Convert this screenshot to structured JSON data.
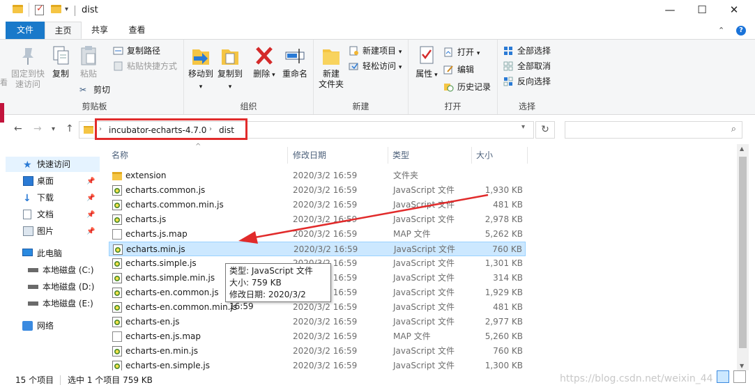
{
  "window": {
    "title": "dist",
    "minimize": "—",
    "maximize": "☐",
    "close": "✕"
  },
  "tabs": [
    "文件",
    "主页",
    "共享",
    "查看"
  ],
  "ribbon": {
    "clipboard": {
      "label": "剪贴板",
      "pin_line1": "固定到快",
      "pin_line2": "速访问",
      "copy": "复制",
      "paste": "粘贴",
      "copy_path": "复制路径",
      "paste_shortcut": "粘贴快捷方式",
      "cut": "剪切"
    },
    "organize": {
      "label": "组织",
      "move_to": "移动到",
      "copy_to": "复制到",
      "delete": "删除",
      "rename": "重命名"
    },
    "new": {
      "label": "新建",
      "new_folder_line1": "新建",
      "new_folder_line2": "文件夹",
      "new_item": "新建项目",
      "easy_access": "轻松访问"
    },
    "open": {
      "label": "打开",
      "properties": "属性",
      "open": "打开",
      "edit": "编辑",
      "history": "历史记录"
    },
    "select": {
      "label": "选择",
      "select_all": "全部选择",
      "select_none": "全部取消",
      "invert": "反向选择"
    }
  },
  "address": {
    "crumbs": [
      "incubator-echarts-4.7.0",
      "dist"
    ]
  },
  "navpane": {
    "quick_access": "快速访问",
    "desktop": "桌面",
    "downloads": "下载",
    "documents": "文档",
    "pictures": "图片",
    "this_pc": "此电脑",
    "drive_c": "本地磁盘 (C:)",
    "drive_d": "本地磁盘 (D:)",
    "drive_e": "本地磁盘 (E:)",
    "network": "网络"
  },
  "columns": {
    "name": "名称",
    "date": "修改日期",
    "type": "类型",
    "size": "大小"
  },
  "files": [
    {
      "name": "extension",
      "date": "2020/3/2 16:59",
      "type": "文件夹",
      "size": "",
      "icon": "folder-icon"
    },
    {
      "name": "echarts.common.js",
      "date": "2020/3/2 16:59",
      "type": "JavaScript 文件",
      "size": "1,930 KB",
      "icon": "js-file-icon"
    },
    {
      "name": "echarts.common.min.js",
      "date": "2020/3/2 16:59",
      "type": "JavaScript 文件",
      "size": "481 KB",
      "icon": "js-file-icon"
    },
    {
      "name": "echarts.js",
      "date": "2020/3/2 16:59",
      "type": "JavaScript 文件",
      "size": "2,978 KB",
      "icon": "js-file-icon"
    },
    {
      "name": "echarts.js.map",
      "date": "2020/3/2 16:59",
      "type": "MAP 文件",
      "size": "5,262 KB",
      "icon": "map-file-icon"
    },
    {
      "name": "echarts.min.js",
      "date": "2020/3/2 16:59",
      "type": "JavaScript 文件",
      "size": "760 KB",
      "icon": "js-file-icon"
    },
    {
      "name": "echarts.simple.js",
      "date": "2020/3/2 16:59",
      "type": "JavaScript 文件",
      "size": "1,301 KB",
      "icon": "js-file-icon"
    },
    {
      "name": "echarts.simple.min.js",
      "date": "2020/3/2 16:59",
      "type": "JavaScript 文件",
      "size": "314 KB",
      "icon": "js-file-icon"
    },
    {
      "name": "echarts-en.common.js",
      "date": "2020/3/2 16:59",
      "type": "JavaScript 文件",
      "size": "1,929 KB",
      "icon": "js-file-icon"
    },
    {
      "name": "echarts-en.common.min.js",
      "date": "2020/3/2 16:59",
      "type": "JavaScript 文件",
      "size": "481 KB",
      "icon": "js-file-icon"
    },
    {
      "name": "echarts-en.js",
      "date": "2020/3/2 16:59",
      "type": "JavaScript 文件",
      "size": "2,977 KB",
      "icon": "js-file-icon"
    },
    {
      "name": "echarts-en.js.map",
      "date": "2020/3/2 16:59",
      "type": "MAP 文件",
      "size": "5,260 KB",
      "icon": "map-file-icon"
    },
    {
      "name": "echarts-en.min.js",
      "date": "2020/3/2 16:59",
      "type": "JavaScript 文件",
      "size": "760 KB",
      "icon": "js-file-icon"
    },
    {
      "name": "echarts-en.simple.js",
      "date": "2020/3/2 16:59",
      "type": "JavaScript 文件",
      "size": "1,300 KB",
      "icon": "js-file-icon"
    }
  ],
  "selected_index": 5,
  "tooltip": {
    "type": "类型: JavaScript 文件",
    "size": "大小: 759 KB",
    "modified": "修改日期: 2020/3/2 16:59"
  },
  "status": {
    "count": "15 个项目",
    "selection": "选中 1 个项目  759 KB"
  },
  "watermark": "https://blog.csdn.net/weixin_44",
  "colors": {
    "accent": "#1979ca",
    "selection": "#cce8ff",
    "annotation_red": "#e12b2b"
  }
}
